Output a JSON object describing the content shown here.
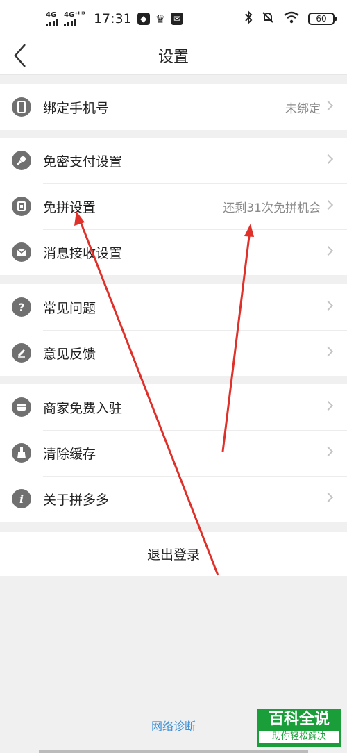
{
  "status_bar": {
    "network_1": "4G",
    "network_2": "4G⁺ᴴᴰ",
    "time": "17:31",
    "battery": "60"
  },
  "nav": {
    "title": "设置"
  },
  "groups": [
    [
      {
        "icon": "phone-icon",
        "label": "绑定手机号",
        "value": "未绑定"
      }
    ],
    [
      {
        "icon": "key-icon",
        "label": "免密支付设置",
        "value": ""
      },
      {
        "icon": "card-icon",
        "label": "免拼设置",
        "value": "还剩31次免拼机会"
      },
      {
        "icon": "mail-icon",
        "label": "消息接收设置",
        "value": ""
      }
    ],
    [
      {
        "icon": "question-icon",
        "label": "常见问题",
        "value": ""
      },
      {
        "icon": "pencil-icon",
        "label": "意见反馈",
        "value": ""
      }
    ],
    [
      {
        "icon": "shop-icon",
        "label": "商家免费入驻",
        "value": ""
      },
      {
        "icon": "broom-icon",
        "label": "清除缓存",
        "value": ""
      },
      {
        "icon": "info-icon",
        "label": "关于拼多多",
        "value": ""
      }
    ]
  ],
  "logout_label": "退出登录",
  "network_diag": "网络诊断",
  "watermark": {
    "title": "百科全说",
    "subtitle": "助你轻松解决"
  },
  "annotation_color": "#e0302a"
}
